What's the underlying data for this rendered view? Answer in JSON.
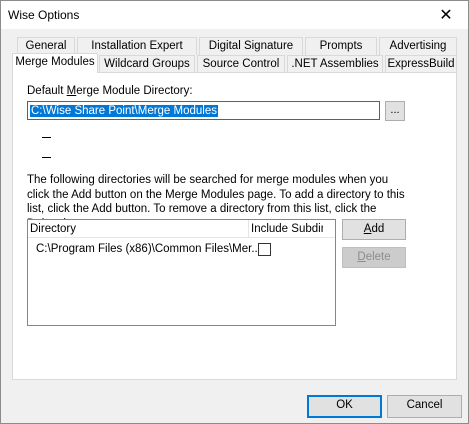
{
  "window": {
    "title": "Wise Options"
  },
  "tabs_back": [
    {
      "label": "General"
    },
    {
      "label": "Installation Expert"
    },
    {
      "label": "Digital Signature"
    },
    {
      "label": "Prompts"
    },
    {
      "label": "Advertising"
    }
  ],
  "tabs_front": [
    {
      "label": "Merge Modules"
    },
    {
      "label": "Wildcard Groups"
    },
    {
      "label": "Source Control"
    },
    {
      "label": ".NET Assemblies"
    },
    {
      "label": "ExpressBuild"
    }
  ],
  "panel": {
    "default_dir_label_pre": "Default ",
    "default_dir_label_mnemonic": "M",
    "default_dir_label_post": "erge Module Directory:",
    "default_dir_value": "C:\\Wise Share Point\\Merge Modules",
    "browse_label": "...",
    "description": "The following directories will be searched for merge modules when you click the Add button on the Merge Modules page. To add a directory to this list, click the Add button. To remove a directory from this list, click the Delete button.",
    "list": {
      "columns": [
        "Directory",
        "Include Subdirs"
      ],
      "rows": [
        {
          "directory": "C:\\Program Files (x86)\\Common Files\\Mer...",
          "include_subdirs": false
        }
      ]
    },
    "add_mnemonic": "A",
    "add_rest": "dd",
    "delete_mnemonic": "D",
    "delete_rest": "elete"
  },
  "footer": {
    "ok_label": "OK",
    "cancel_label": "Cancel"
  }
}
